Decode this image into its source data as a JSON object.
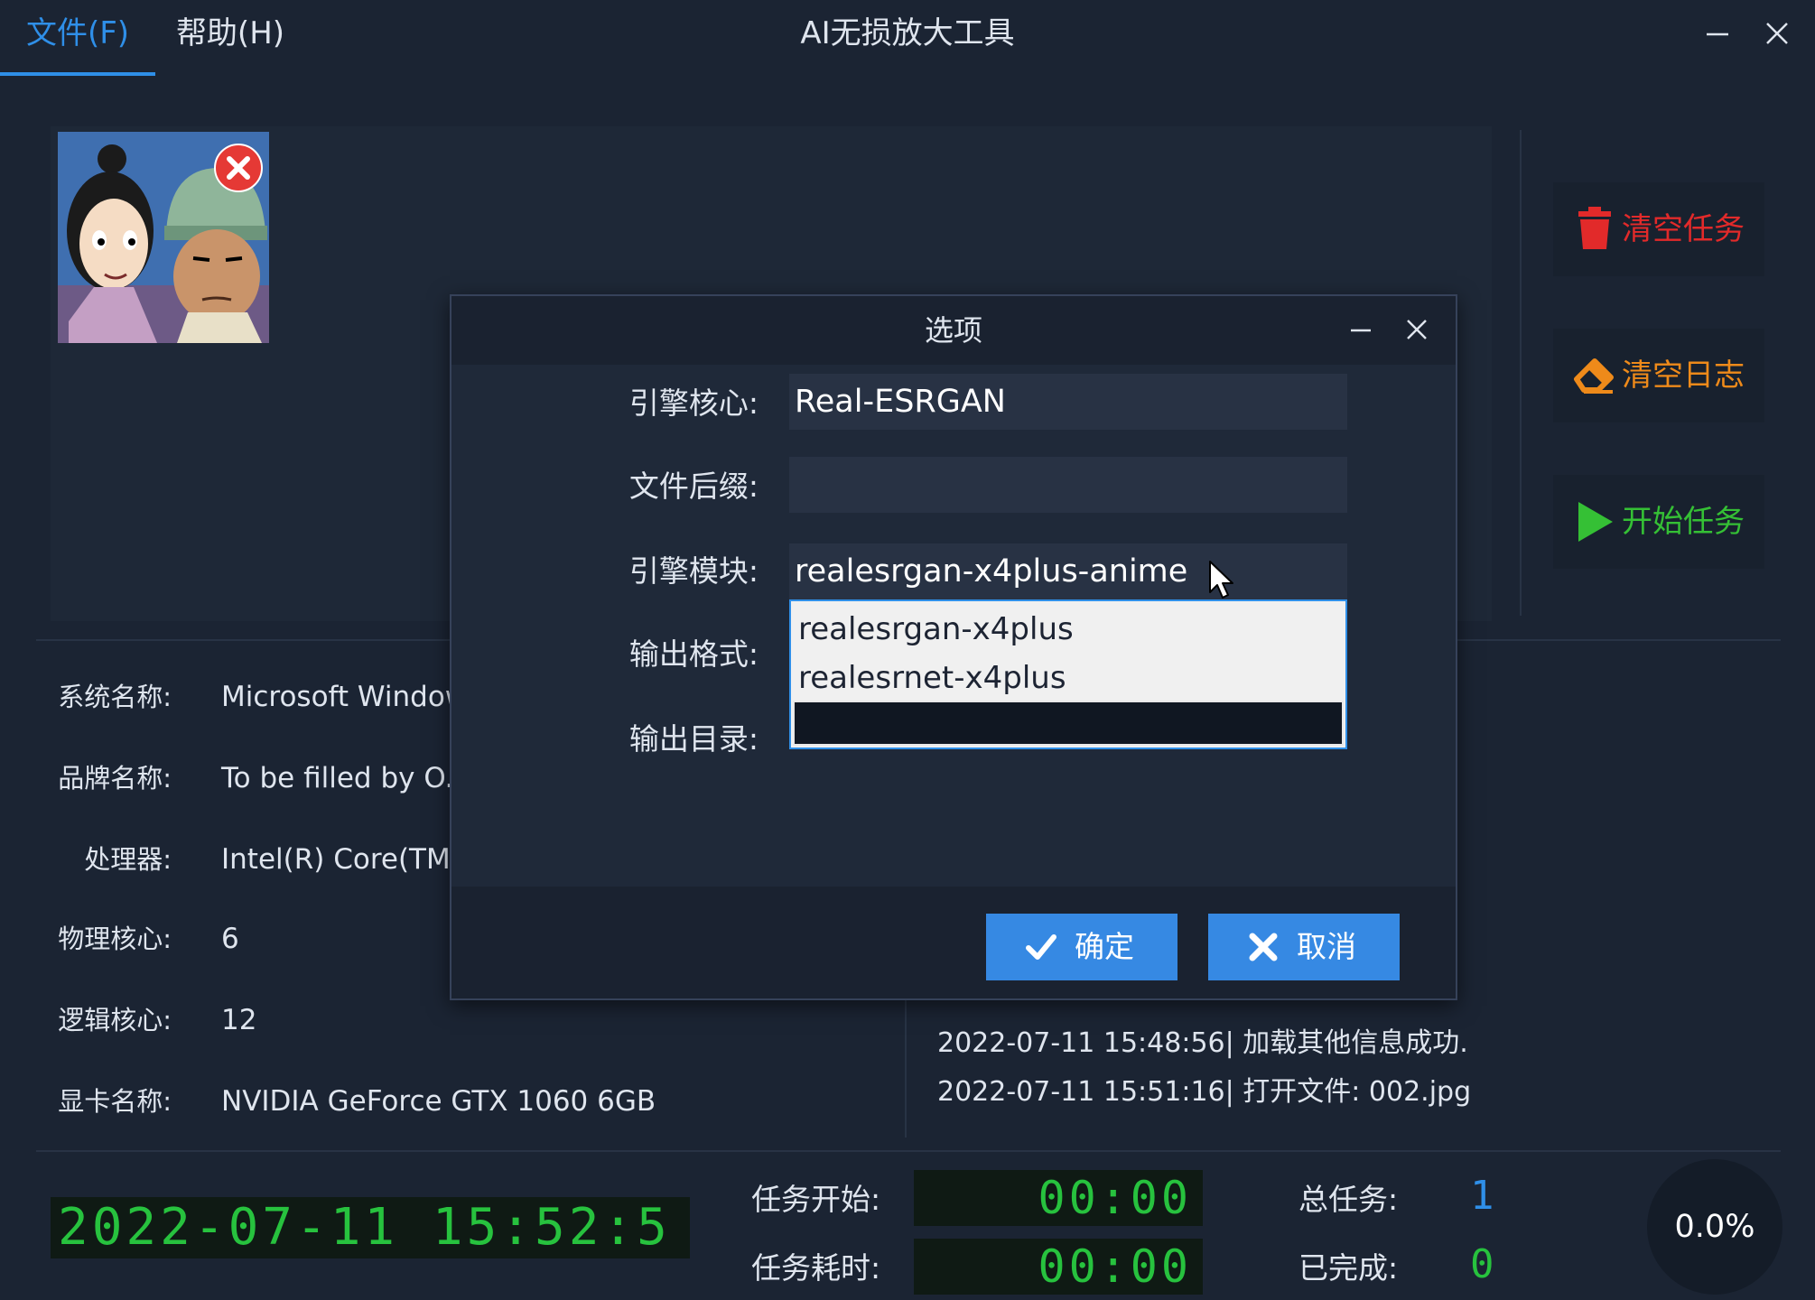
{
  "menu": {
    "file": "文件(F)",
    "help": "帮助(H)"
  },
  "app_title": "AI无损放大工具",
  "side_buttons": {
    "clear_tasks": "清空任务",
    "clear_log": "清空日志",
    "start_task": "开始任务"
  },
  "system_info": [
    {
      "label": "系统名称:",
      "value": "Microsoft Window"
    },
    {
      "label": "品牌名称:",
      "value": "To be filled by O.E"
    },
    {
      "label": "处理器:",
      "value": "Intel(R) Core(TM)"
    },
    {
      "label": "物理核心:",
      "value": "6"
    },
    {
      "label": "逻辑核心:",
      "value": "12"
    },
    {
      "label": "显卡名称:",
      "value": "NVIDIA GeForce GTX 1060 6GB"
    }
  ],
  "log": [
    "2022-07-11 15:48:56| 加载其他信息成功.",
    "2022-07-11 15:51:16| 打开文件: 002.jpg"
  ],
  "status": {
    "datetime": "2022-07-11 15:52:5",
    "task_start_label": "任务开始:",
    "task_start_value": "00:00",
    "task_elapsed_label": "任务耗时:",
    "task_elapsed_value": "00:00",
    "total_label": "总任务:",
    "total_value": "1",
    "done_label": "已完成:",
    "done_value": "0",
    "progress": "0.0%"
  },
  "dialog": {
    "title": "选项",
    "engine_core_label": "引擎核心:",
    "engine_core_value": "Real-ESRGAN",
    "file_suffix_label": "文件后缀:",
    "file_suffix_value": "",
    "engine_module_label": "引擎模块:",
    "engine_module_value": "realesrgan-x4plus-anime",
    "output_format_label": "输出格式:",
    "output_dir_label": "输出目录:",
    "dropdown_options": [
      "realesrgan-x4plus",
      "realesrnet-x4plus"
    ],
    "ok_button": "确定",
    "cancel_button": "取消"
  },
  "colors": {
    "accent": "#2f8fe8",
    "danger": "#e22a2a",
    "warning": "#ee8a1a",
    "success": "#35c035",
    "lcd_green": "#27c23e",
    "button_blue": "#3689e3"
  }
}
